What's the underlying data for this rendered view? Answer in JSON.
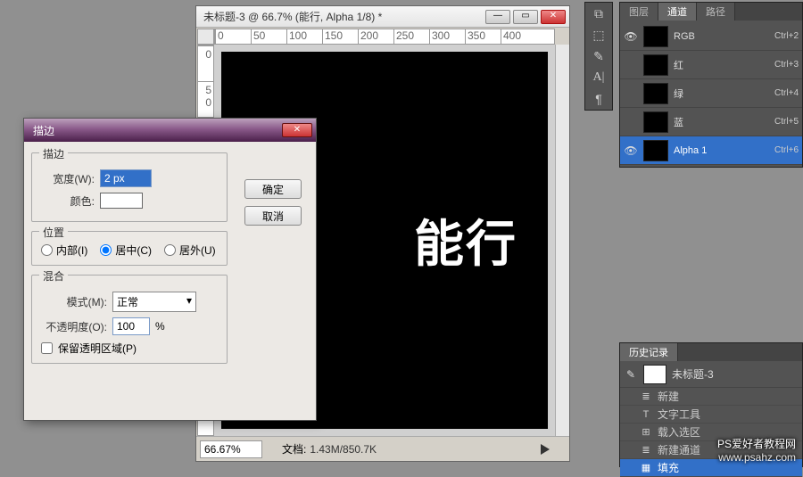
{
  "doc": {
    "title": "未标题-3 @ 66.7% (能行, Alpha 1/8) *",
    "canvas_text": "能行",
    "status_zoom": "66.67%",
    "status_doc_label": "文档:",
    "status_doc_size": "1.43M/850.7K"
  },
  "dialog": {
    "title": "描边",
    "group_stroke": "描边",
    "width_label": "宽度(W):",
    "width_value": "2 px",
    "color_label": "颜色:",
    "group_position": "位置",
    "pos_inside": "内部(I)",
    "pos_center": "居中(C)",
    "pos_outside": "居外(U)",
    "group_blend": "混合",
    "mode_label": "模式(M):",
    "mode_value": "正常",
    "opacity_label": "不透明度(O):",
    "opacity_value": "100",
    "opacity_unit": "%",
    "preserve_label": "保留透明区域(P)",
    "ok": "确定",
    "cancel": "取消"
  },
  "panel_tabs": {
    "layers": "图层",
    "channels": "通道",
    "paths": "路径"
  },
  "channels": [
    {
      "name": "RGB",
      "shortcut": "Ctrl+2",
      "thumb": "dark",
      "eye": true
    },
    {
      "name": "红",
      "shortcut": "Ctrl+3",
      "thumb": "dark",
      "eye": false
    },
    {
      "name": "绿",
      "shortcut": "Ctrl+4",
      "thumb": "dark",
      "eye": false
    },
    {
      "name": "蓝",
      "shortcut": "Ctrl+5",
      "thumb": "dark",
      "eye": false
    },
    {
      "name": "Alpha 1",
      "shortcut": "Ctrl+6",
      "thumb": "dark",
      "eye": true,
      "selected": true
    }
  ],
  "history": {
    "tab": "历史记录",
    "doc": "未标题-3",
    "items": [
      {
        "icon": "≣",
        "label": "新建"
      },
      {
        "icon": "T",
        "label": "文字工具"
      },
      {
        "icon": "⊞",
        "label": "载入选区"
      },
      {
        "icon": "≣",
        "label": "新建通道"
      },
      {
        "icon": "▦",
        "label": "填充",
        "selected": true
      }
    ]
  },
  "watermark": {
    "line1": "PS爱好者教程网",
    "line2": "www.psahz.com"
  }
}
